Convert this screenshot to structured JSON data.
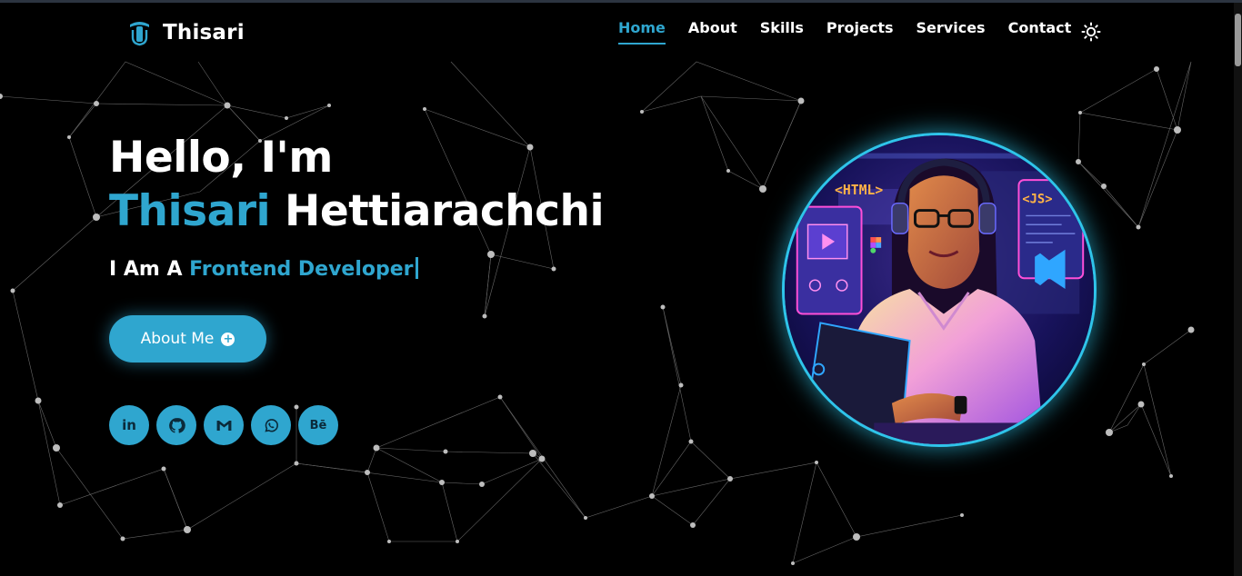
{
  "brand": {
    "name": "Thisari",
    "logo_icon": "t-logo-icon"
  },
  "nav": {
    "items": [
      {
        "label": "Home",
        "active": true
      },
      {
        "label": "About",
        "active": false
      },
      {
        "label": "Skills",
        "active": false
      },
      {
        "label": "Projects",
        "active": false
      },
      {
        "label": "Services",
        "active": false
      },
      {
        "label": "Contact",
        "active": false
      }
    ],
    "theme_toggle_icon": "sun-icon"
  },
  "hero": {
    "greeting": "Hello, I'm",
    "first_name": "Thisari",
    "last_name": "Hettiarachchi",
    "role_prefix": "I Am A",
    "role": "Frontend Developer",
    "cta_label": "About Me",
    "cta_icon": "plus-circle-icon"
  },
  "socials": [
    {
      "name": "linkedin-icon",
      "label": "in"
    },
    {
      "name": "github-icon",
      "label": ""
    },
    {
      "name": "gmail-icon",
      "label": ""
    },
    {
      "name": "whatsapp-icon",
      "label": ""
    },
    {
      "name": "behance-icon",
      "label": "Bē"
    }
  ],
  "illustration": {
    "left_tag": "<HTML>",
    "right_tag": "<JS>"
  },
  "colors": {
    "accent": "#2fa6cf",
    "glow": "#2fc4ea",
    "background": "#000000"
  }
}
